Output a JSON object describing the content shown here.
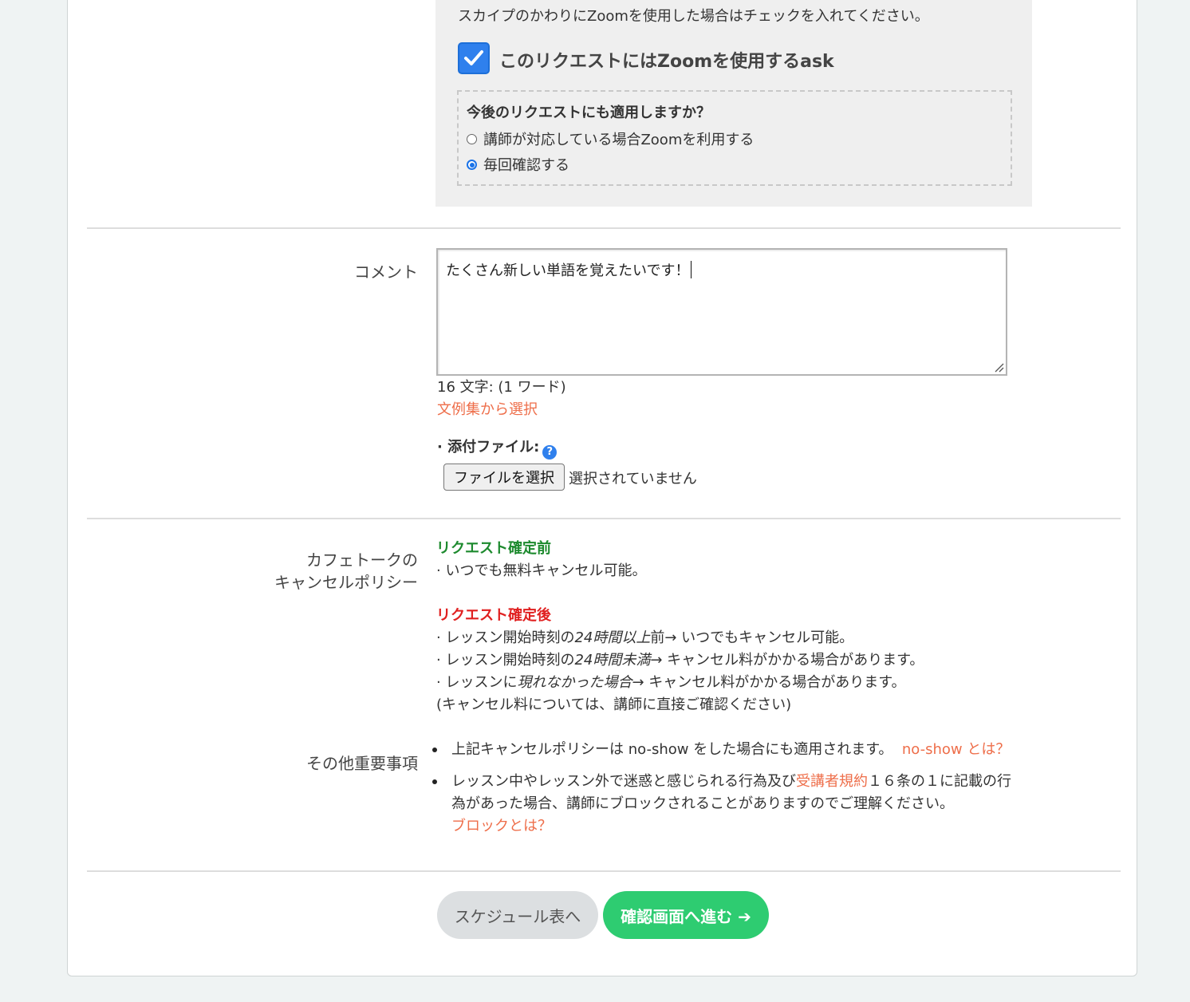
{
  "zoom": {
    "note": "スカイプのかわりにZoomを使用した場合はチェックを入れてください。",
    "checkbox_label": "このリクエストにはZoomを使用するask",
    "checked": true,
    "future_title": "今後のリクエストにも適用しますか？",
    "options": [
      {
        "label": "講師が対応している場合Zoomを利用する",
        "selected": false
      },
      {
        "label": "毎回確認する",
        "selected": true
      }
    ]
  },
  "comment": {
    "label": "コメント",
    "value": "たくさん新しい単語を覚えたいです！",
    "count": "16 文字: (1 ワード)",
    "template_link": "文例集から選択",
    "attach_label": "· 添付ファイル:",
    "help_icon": "question-circle-icon",
    "file_button": "ファイルを選択",
    "file_status": "選択されていません"
  },
  "policy": {
    "label_line1": "カフェトークの",
    "label_line2": "キャンセルポリシー",
    "before_title": "リクエスト確定前",
    "before_items": [
      "· いつでも無料キャンセル可能。"
    ],
    "after_title": "リクエスト確定後",
    "after_items": [
      {
        "prefix": "· レッスン開始時刻の",
        "em": "24時間以上",
        "suffix": "前→ いつでもキャンセル可能。"
      },
      {
        "prefix": "· レッスン開始時刻の",
        "em": "24時間未満",
        "suffix": "→ キャンセル料がかかる場合があります。"
      },
      {
        "prefix": "· レッスンに",
        "em": "現れなかった場合",
        "suffix": "→ キャンセル料がかかる場合があります。"
      }
    ],
    "note": "(キャンセル料については、講師に直接ご確認ください)"
  },
  "other": {
    "label": "その他重要事項",
    "item1_text": "上記キャンセルポリシーは no-show をした場合にも適用されます。",
    "item1_link": "no-show とは？",
    "item2_pre": "レッスン中やレッスン外で迷惑と感じられる行為及び",
    "item2_link": "受講者規約",
    "item2_post1": "１６条の１に記載の行",
    "item2_post2": "為があった場合、講師にブロックされることがありますのでご理解ください。",
    "item2_link2": "ブロックとは？"
  },
  "buttons": {
    "schedule": "スケジュール表へ",
    "confirm": "確認画面へ進む ➔"
  },
  "colors": {
    "accent_blue": "#2f80ed",
    "link": "#ee6e4a",
    "green_button": "#2ecc71",
    "green_text": "#1d8a2e",
    "red_text": "#e02020"
  }
}
